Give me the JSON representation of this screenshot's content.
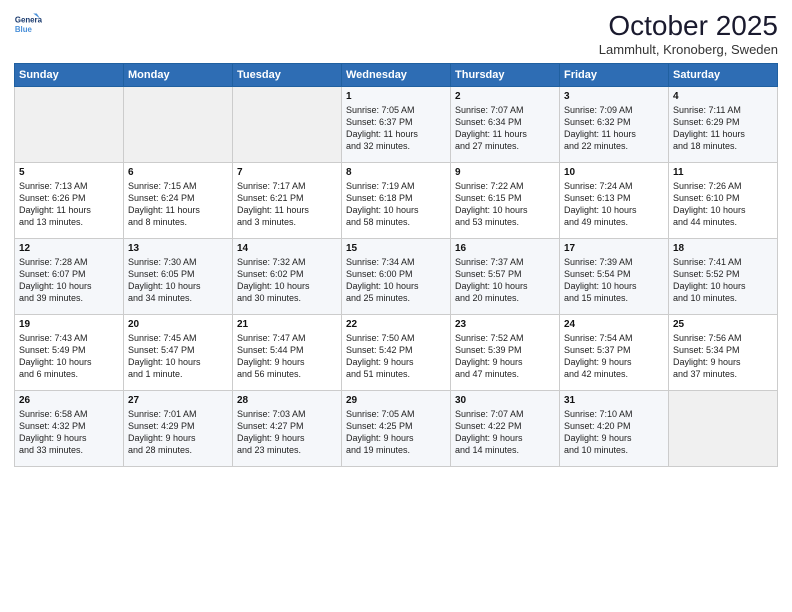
{
  "logo": {
    "line1": "General",
    "line2": "Blue"
  },
  "title": "October 2025",
  "subtitle": "Lammhult, Kronoberg, Sweden",
  "days_of_week": [
    "Sunday",
    "Monday",
    "Tuesday",
    "Wednesday",
    "Thursday",
    "Friday",
    "Saturday"
  ],
  "weeks": [
    [
      {
        "day": "",
        "info": ""
      },
      {
        "day": "",
        "info": ""
      },
      {
        "day": "",
        "info": ""
      },
      {
        "day": "1",
        "info": "Sunrise: 7:05 AM\nSunset: 6:37 PM\nDaylight: 11 hours\nand 32 minutes."
      },
      {
        "day": "2",
        "info": "Sunrise: 7:07 AM\nSunset: 6:34 PM\nDaylight: 11 hours\nand 27 minutes."
      },
      {
        "day": "3",
        "info": "Sunrise: 7:09 AM\nSunset: 6:32 PM\nDaylight: 11 hours\nand 22 minutes."
      },
      {
        "day": "4",
        "info": "Sunrise: 7:11 AM\nSunset: 6:29 PM\nDaylight: 11 hours\nand 18 minutes."
      }
    ],
    [
      {
        "day": "5",
        "info": "Sunrise: 7:13 AM\nSunset: 6:26 PM\nDaylight: 11 hours\nand 13 minutes."
      },
      {
        "day": "6",
        "info": "Sunrise: 7:15 AM\nSunset: 6:24 PM\nDaylight: 11 hours\nand 8 minutes."
      },
      {
        "day": "7",
        "info": "Sunrise: 7:17 AM\nSunset: 6:21 PM\nDaylight: 11 hours\nand 3 minutes."
      },
      {
        "day": "8",
        "info": "Sunrise: 7:19 AM\nSunset: 6:18 PM\nDaylight: 10 hours\nand 58 minutes."
      },
      {
        "day": "9",
        "info": "Sunrise: 7:22 AM\nSunset: 6:15 PM\nDaylight: 10 hours\nand 53 minutes."
      },
      {
        "day": "10",
        "info": "Sunrise: 7:24 AM\nSunset: 6:13 PM\nDaylight: 10 hours\nand 49 minutes."
      },
      {
        "day": "11",
        "info": "Sunrise: 7:26 AM\nSunset: 6:10 PM\nDaylight: 10 hours\nand 44 minutes."
      }
    ],
    [
      {
        "day": "12",
        "info": "Sunrise: 7:28 AM\nSunset: 6:07 PM\nDaylight: 10 hours\nand 39 minutes."
      },
      {
        "day": "13",
        "info": "Sunrise: 7:30 AM\nSunset: 6:05 PM\nDaylight: 10 hours\nand 34 minutes."
      },
      {
        "day": "14",
        "info": "Sunrise: 7:32 AM\nSunset: 6:02 PM\nDaylight: 10 hours\nand 30 minutes."
      },
      {
        "day": "15",
        "info": "Sunrise: 7:34 AM\nSunset: 6:00 PM\nDaylight: 10 hours\nand 25 minutes."
      },
      {
        "day": "16",
        "info": "Sunrise: 7:37 AM\nSunset: 5:57 PM\nDaylight: 10 hours\nand 20 minutes."
      },
      {
        "day": "17",
        "info": "Sunrise: 7:39 AM\nSunset: 5:54 PM\nDaylight: 10 hours\nand 15 minutes."
      },
      {
        "day": "18",
        "info": "Sunrise: 7:41 AM\nSunset: 5:52 PM\nDaylight: 10 hours\nand 10 minutes."
      }
    ],
    [
      {
        "day": "19",
        "info": "Sunrise: 7:43 AM\nSunset: 5:49 PM\nDaylight: 10 hours\nand 6 minutes."
      },
      {
        "day": "20",
        "info": "Sunrise: 7:45 AM\nSunset: 5:47 PM\nDaylight: 10 hours\nand 1 minute."
      },
      {
        "day": "21",
        "info": "Sunrise: 7:47 AM\nSunset: 5:44 PM\nDaylight: 9 hours\nand 56 minutes."
      },
      {
        "day": "22",
        "info": "Sunrise: 7:50 AM\nSunset: 5:42 PM\nDaylight: 9 hours\nand 51 minutes."
      },
      {
        "day": "23",
        "info": "Sunrise: 7:52 AM\nSunset: 5:39 PM\nDaylight: 9 hours\nand 47 minutes."
      },
      {
        "day": "24",
        "info": "Sunrise: 7:54 AM\nSunset: 5:37 PM\nDaylight: 9 hours\nand 42 minutes."
      },
      {
        "day": "25",
        "info": "Sunrise: 7:56 AM\nSunset: 5:34 PM\nDaylight: 9 hours\nand 37 minutes."
      }
    ],
    [
      {
        "day": "26",
        "info": "Sunrise: 6:58 AM\nSunset: 4:32 PM\nDaylight: 9 hours\nand 33 minutes."
      },
      {
        "day": "27",
        "info": "Sunrise: 7:01 AM\nSunset: 4:29 PM\nDaylight: 9 hours\nand 28 minutes."
      },
      {
        "day": "28",
        "info": "Sunrise: 7:03 AM\nSunset: 4:27 PM\nDaylight: 9 hours\nand 23 minutes."
      },
      {
        "day": "29",
        "info": "Sunrise: 7:05 AM\nSunset: 4:25 PM\nDaylight: 9 hours\nand 19 minutes."
      },
      {
        "day": "30",
        "info": "Sunrise: 7:07 AM\nSunset: 4:22 PM\nDaylight: 9 hours\nand 14 minutes."
      },
      {
        "day": "31",
        "info": "Sunrise: 7:10 AM\nSunset: 4:20 PM\nDaylight: 9 hours\nand 10 minutes."
      },
      {
        "day": "",
        "info": ""
      }
    ]
  ]
}
